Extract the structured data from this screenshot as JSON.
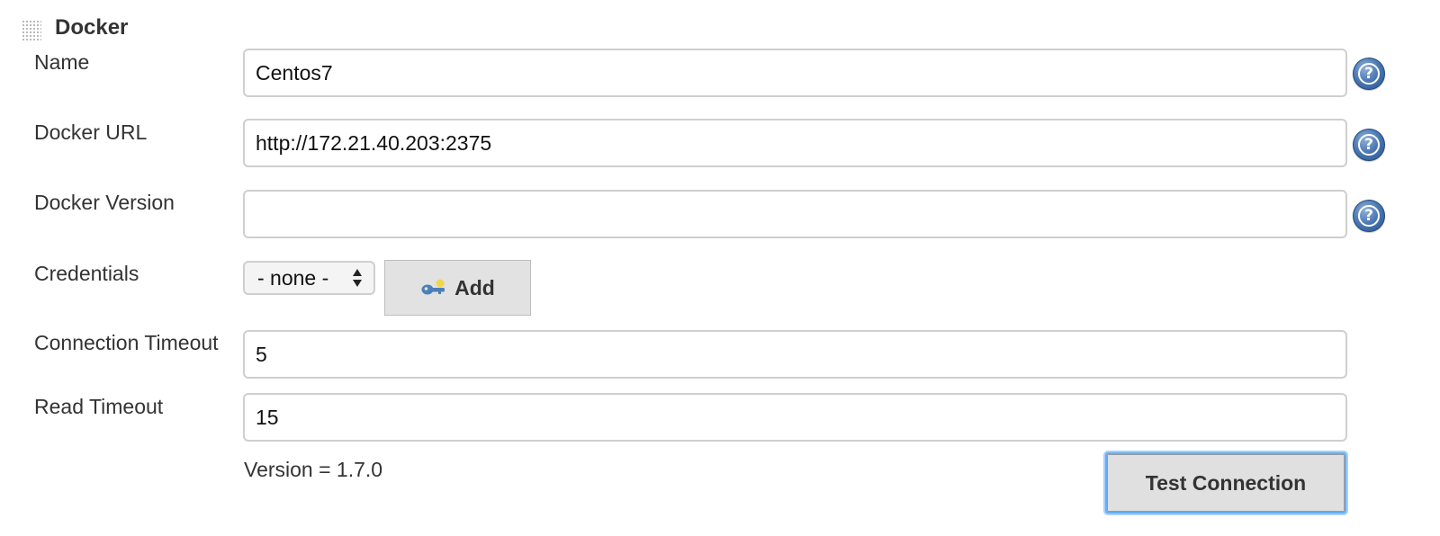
{
  "section": {
    "title": "Docker"
  },
  "fields": {
    "name": {
      "label": "Name",
      "value": "Centos7"
    },
    "docker_url": {
      "label": "Docker URL",
      "value": "http://172.21.40.203:2375"
    },
    "docker_version": {
      "label": "Docker Version",
      "value": ""
    },
    "credentials": {
      "label": "Credentials",
      "selected": "- none -",
      "add_label": "Add"
    },
    "connection_timeout": {
      "label": "Connection Timeout",
      "value": "5"
    },
    "read_timeout": {
      "label": "Read Timeout",
      "value": "15"
    }
  },
  "status": {
    "version_text": "Version = 1.7.0"
  },
  "actions": {
    "test_connection_label": "Test Connection"
  },
  "icons": {
    "help": "help-icon",
    "key": "key-icon",
    "grip": "drag-handle-icon"
  },
  "colors": {
    "help_blue": "#2a5790",
    "focus_ring": "#6aaef0",
    "button_bg": "#e2e2e2"
  }
}
